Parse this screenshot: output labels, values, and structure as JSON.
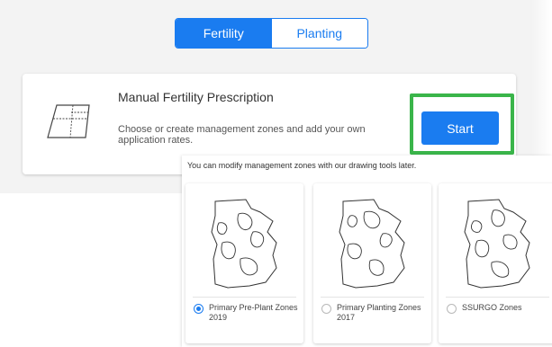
{
  "tabs": [
    {
      "label": "Fertility",
      "active": true
    },
    {
      "label": "Planting",
      "active": false
    }
  ],
  "card": {
    "title": "Manual Fertility Prescription",
    "description": "Choose or create management zones and add your own application rates.",
    "icon": "field-map-icon",
    "start_label": "Start"
  },
  "overlay": {
    "note": "You can modify management zones with our drawing tools later.",
    "zones": [
      {
        "label": "Primary Pre-Plant Zones 2019",
        "selected": true
      },
      {
        "label": "Primary Planting Zones 2017",
        "selected": false
      },
      {
        "label": "SSURGO Zones",
        "selected": false
      }
    ]
  },
  "colors": {
    "accent": "#1a7cf0",
    "highlight": "#3ab54a",
    "panel_bg": "#f3f3f3"
  }
}
